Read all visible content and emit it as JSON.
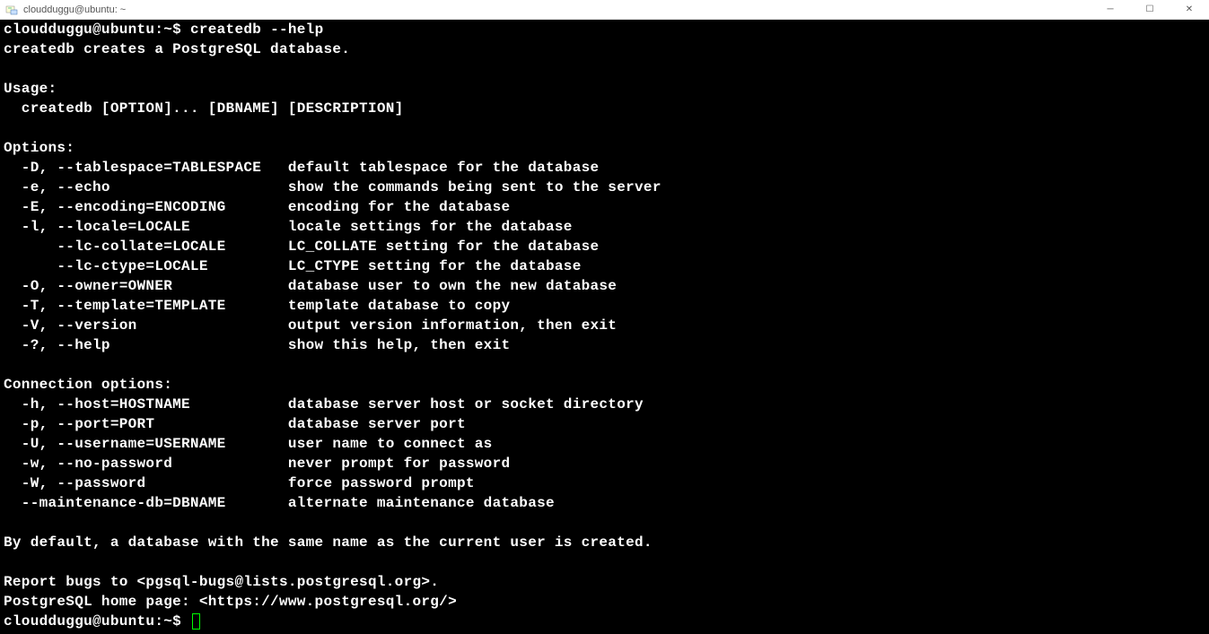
{
  "window": {
    "title": "cloudduggu@ubuntu: ~"
  },
  "prompt": {
    "user_host": "cloudduggu@ubuntu",
    "path": "~",
    "sep": ":",
    "symbol": "$"
  },
  "command": "createdb --help",
  "output": {
    "summary": "createdb creates a PostgreSQL database.",
    "usage_header": "Usage:",
    "usage_line": "  createdb [OPTION]... [DBNAME] [DESCRIPTION]",
    "options_header": "Options:",
    "options": [
      {
        "flag": "-D, --tablespace=TABLESPACE",
        "desc": "default tablespace for the database"
      },
      {
        "flag": "-e, --echo",
        "desc": "show the commands being sent to the server"
      },
      {
        "flag": "-E, --encoding=ENCODING",
        "desc": "encoding for the database"
      },
      {
        "flag": "-l, --locale=LOCALE",
        "desc": "locale settings for the database"
      },
      {
        "flag": "    --lc-collate=LOCALE",
        "desc": "LC_COLLATE setting for the database"
      },
      {
        "flag": "    --lc-ctype=LOCALE",
        "desc": "LC_CTYPE setting for the database"
      },
      {
        "flag": "-O, --owner=OWNER",
        "desc": "database user to own the new database"
      },
      {
        "flag": "-T, --template=TEMPLATE",
        "desc": "template database to copy"
      },
      {
        "flag": "-V, --version",
        "desc": "output version information, then exit"
      },
      {
        "flag": "-?, --help",
        "desc": "show this help, then exit"
      }
    ],
    "conn_header": "Connection options:",
    "conn_options": [
      {
        "flag": "-h, --host=HOSTNAME",
        "desc": "database server host or socket directory"
      },
      {
        "flag": "-p, --port=PORT",
        "desc": "database server port"
      },
      {
        "flag": "-U, --username=USERNAME",
        "desc": "user name to connect as"
      },
      {
        "flag": "-w, --no-password",
        "desc": "never prompt for password"
      },
      {
        "flag": "-W, --password",
        "desc": "force password prompt"
      },
      {
        "flag": "--maintenance-db=DBNAME",
        "desc": "alternate maintenance database"
      }
    ],
    "footer1": "By default, a database with the same name as the current user is created.",
    "footer2": "Report bugs to <pgsql-bugs@lists.postgresql.org>.",
    "footer3": "PostgreSQL home page: <https://www.postgresql.org/>"
  }
}
